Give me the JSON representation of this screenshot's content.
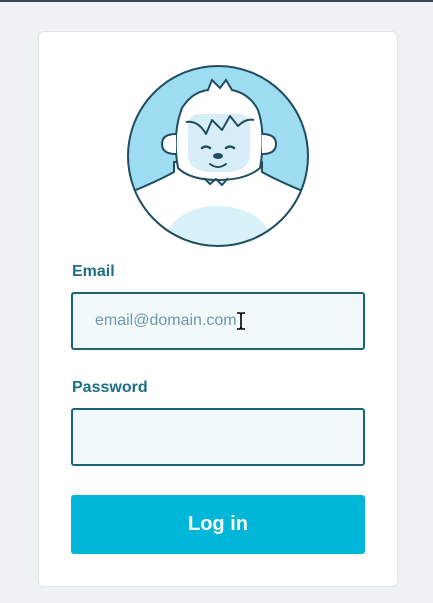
{
  "form": {
    "email_label": "Email",
    "email_placeholder": "email@domain.com",
    "email_value": "",
    "password_label": "Password",
    "password_value": "",
    "login_label": "Log in"
  },
  "avatar": {
    "icon": "yeti-avatar-icon"
  },
  "colors": {
    "page_background": "#eef2f2",
    "accent": "#00b7d9",
    "label_text": "#1d6f86",
    "input_border": "#1a6475",
    "avatar_background": "#9dddf2"
  }
}
